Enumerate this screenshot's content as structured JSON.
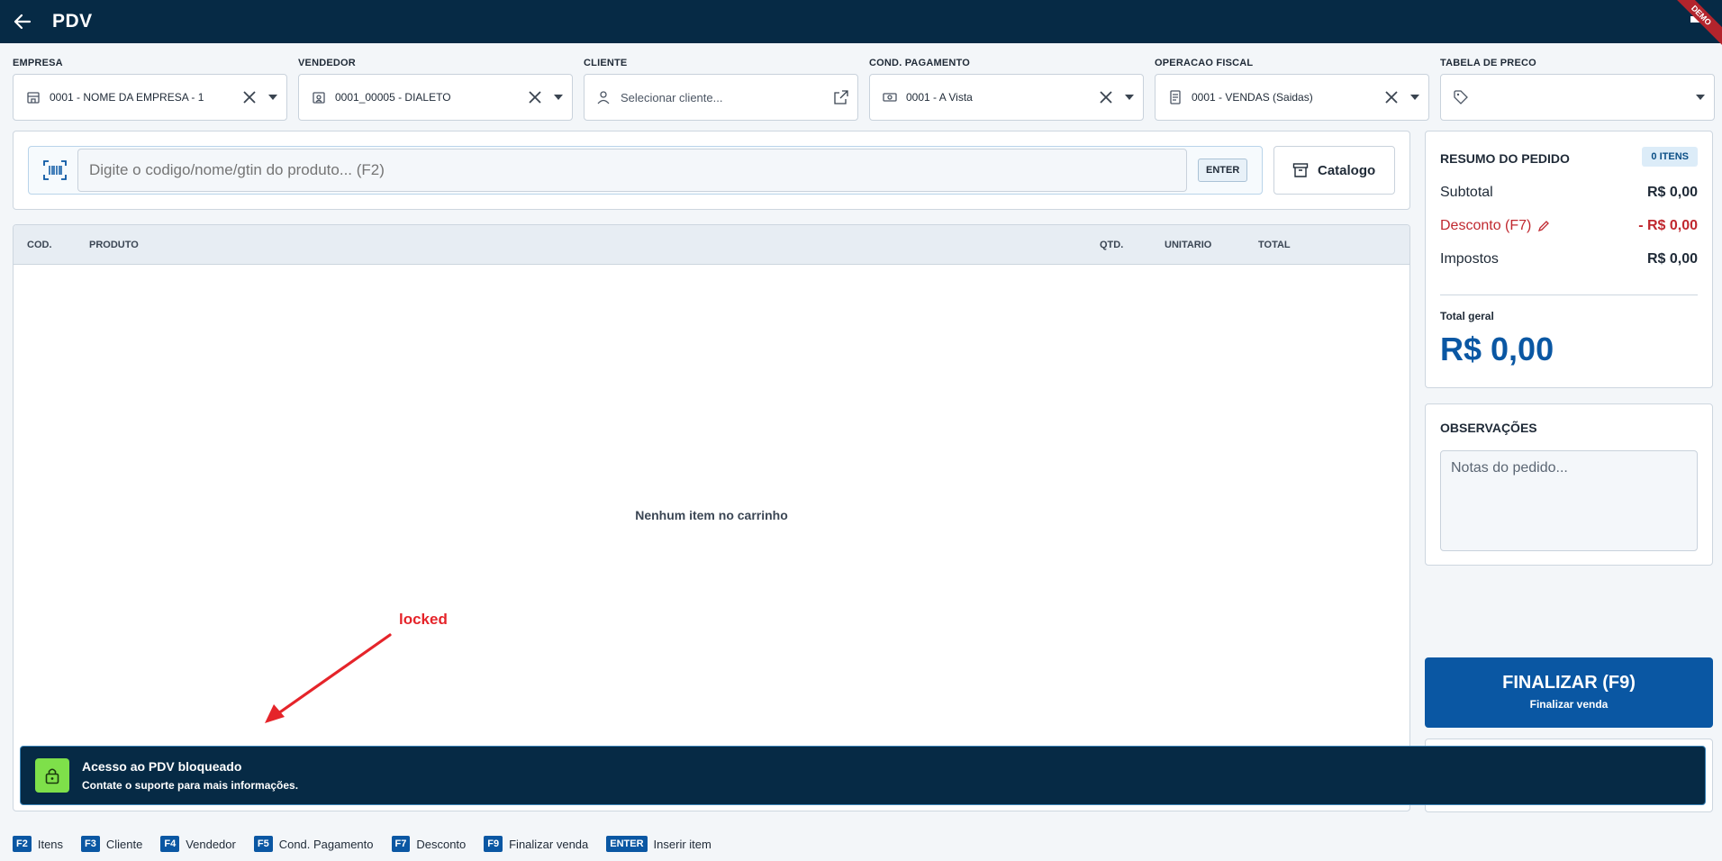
{
  "app": {
    "title": "PDV",
    "ribbon": "DEMO"
  },
  "filters": [
    {
      "label": "EMPRESA",
      "value": "0001 - NOME DA EMPRESA - 1",
      "icon": "store-icon"
    },
    {
      "label": "VENDEDOR",
      "value": "0001_00005 - DIALETO",
      "icon": "id-badge-icon"
    },
    {
      "label": "CLIENTE",
      "placeholder": "Selecionar cliente...",
      "icon": "user-icon"
    },
    {
      "label": "COND. PAGAMENTO",
      "value": "0001 - A Vista",
      "icon": "cash-icon"
    },
    {
      "label": "OPERACAO FISCAL",
      "value": "0001 - VENDAS (Saidas)",
      "icon": "receipt-icon"
    },
    {
      "label": "TABELA DE PRECO",
      "value": "",
      "icon": "tag-icon"
    }
  ],
  "search": {
    "placeholder": "Digite o codigo/nome/gtin do produto... (F2)",
    "enter_label": "ENTER",
    "catalog_label": "Catalogo"
  },
  "cart": {
    "columns": {
      "cod": "COD.",
      "produto": "PRODUTO",
      "qtd": "QTD.",
      "unitario": "UNITARIO",
      "total": "TOTAL"
    },
    "empty_message": "Nenhum item no carrinho"
  },
  "summary": {
    "title": "RESUMO DO PEDIDO",
    "items_badge": "0 ITENS",
    "subtotal_label": "Subtotal",
    "subtotal_value": "R$ 0,00",
    "discount_label": "Desconto (F7)",
    "discount_value": "- R$ 0,00",
    "taxes_label": "Impostos",
    "taxes_value": "R$ 0,00",
    "total_label": "Total geral",
    "total_value": "R$ 0,00"
  },
  "observations": {
    "title": "OBSERVAÇÕES",
    "placeholder": "Notas do pedido..."
  },
  "finalize": {
    "label": "FINALIZAR (F9)",
    "sublabel": "Finalizar venda"
  },
  "lock_banner": {
    "title": "Acesso ao PDV bloqueado",
    "message": "Contate o suporte para mais informações."
  },
  "annotation": {
    "text": "locked",
    "color": "#e5242a"
  },
  "shortcuts": [
    {
      "key": "F2",
      "label": "Itens"
    },
    {
      "key": "F3",
      "label": "Cliente"
    },
    {
      "key": "F4",
      "label": "Vendedor"
    },
    {
      "key": "F5",
      "label": "Cond. Pagamento"
    },
    {
      "key": "F7",
      "label": "Desconto"
    },
    {
      "key": "F9",
      "label": "Finalizar venda"
    },
    {
      "key": "ENTER",
      "label": "Inserir item"
    }
  ],
  "colors": {
    "header": "#062a45",
    "accent": "#0a57a3",
    "discount": "#c0282f",
    "lock": "#7ee04a"
  }
}
